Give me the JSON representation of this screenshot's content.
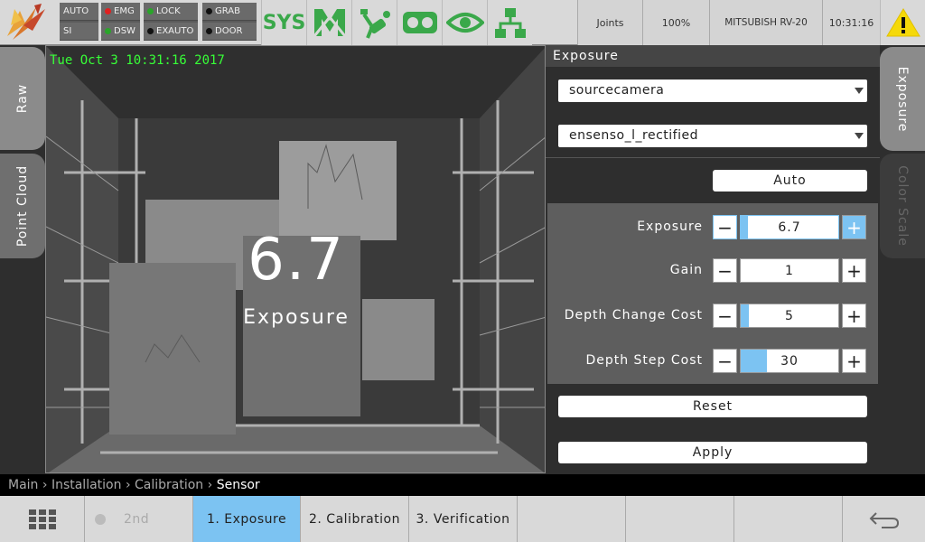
{
  "topbar": {
    "status": {
      "auto": "AUTO",
      "si": "SI",
      "emg": "EMG",
      "dsw": "DSW",
      "lock": "LOCK",
      "exauto": "EXAUTO",
      "grab": "GRAB",
      "door": "DOOR"
    },
    "status_colors": {
      "emg": "#e02020",
      "dsw": "#2aa52a",
      "lock": "#2aa52a",
      "exauto": "#111111",
      "grab": "#111111",
      "door": "#111111"
    },
    "sys_label": "SYS",
    "icons": [
      "logo-icon",
      "sys-icon",
      "m-logo-icon",
      "gripper-icon",
      "camera-icon",
      "eye-icon",
      "network-icon"
    ],
    "joints_label": "Joints",
    "speed_label": "100%",
    "robot_label": "MITSUBISH RV-20",
    "clock": "10:31:16",
    "warning_icon": "warning-icon"
  },
  "left_tabs": {
    "raw": "Raw",
    "point_cloud": "Point Cloud"
  },
  "camera": {
    "timestamp": "Tue Oct  3 10:31:16 2017",
    "overlay_value": "6.7",
    "overlay_label": "Exposure"
  },
  "panel": {
    "title": "Exposure",
    "source_select": "sourcecamera",
    "stream_select": "ensenso_l_rectified",
    "auto_label": "Auto",
    "params": [
      {
        "label": "Exposure",
        "value": "6.7",
        "fill": 0.02,
        "active": true
      },
      {
        "label": "Gain",
        "value": "1",
        "fill": 0.0,
        "active": false
      },
      {
        "label": "Depth Change Cost",
        "value": "5",
        "fill": 0.08,
        "active": false
      },
      {
        "label": "Depth Step Cost",
        "value": "30",
        "fill": 0.27,
        "active": false
      }
    ],
    "reset_label": "Reset",
    "apply_label": "Apply"
  },
  "right_tabs": {
    "exposure": "Exposure",
    "color_scale": "Color Scale"
  },
  "breadcrumb": {
    "items": [
      "Main",
      "Installation",
      "Calibration"
    ],
    "current": "Sensor"
  },
  "bottombar": {
    "grid_icon": "grid-icon",
    "second_label": "2nd",
    "steps": [
      "1. Exposure",
      "2. Calibration",
      "3. Verification"
    ],
    "back_icon": "back-arrow-icon"
  }
}
